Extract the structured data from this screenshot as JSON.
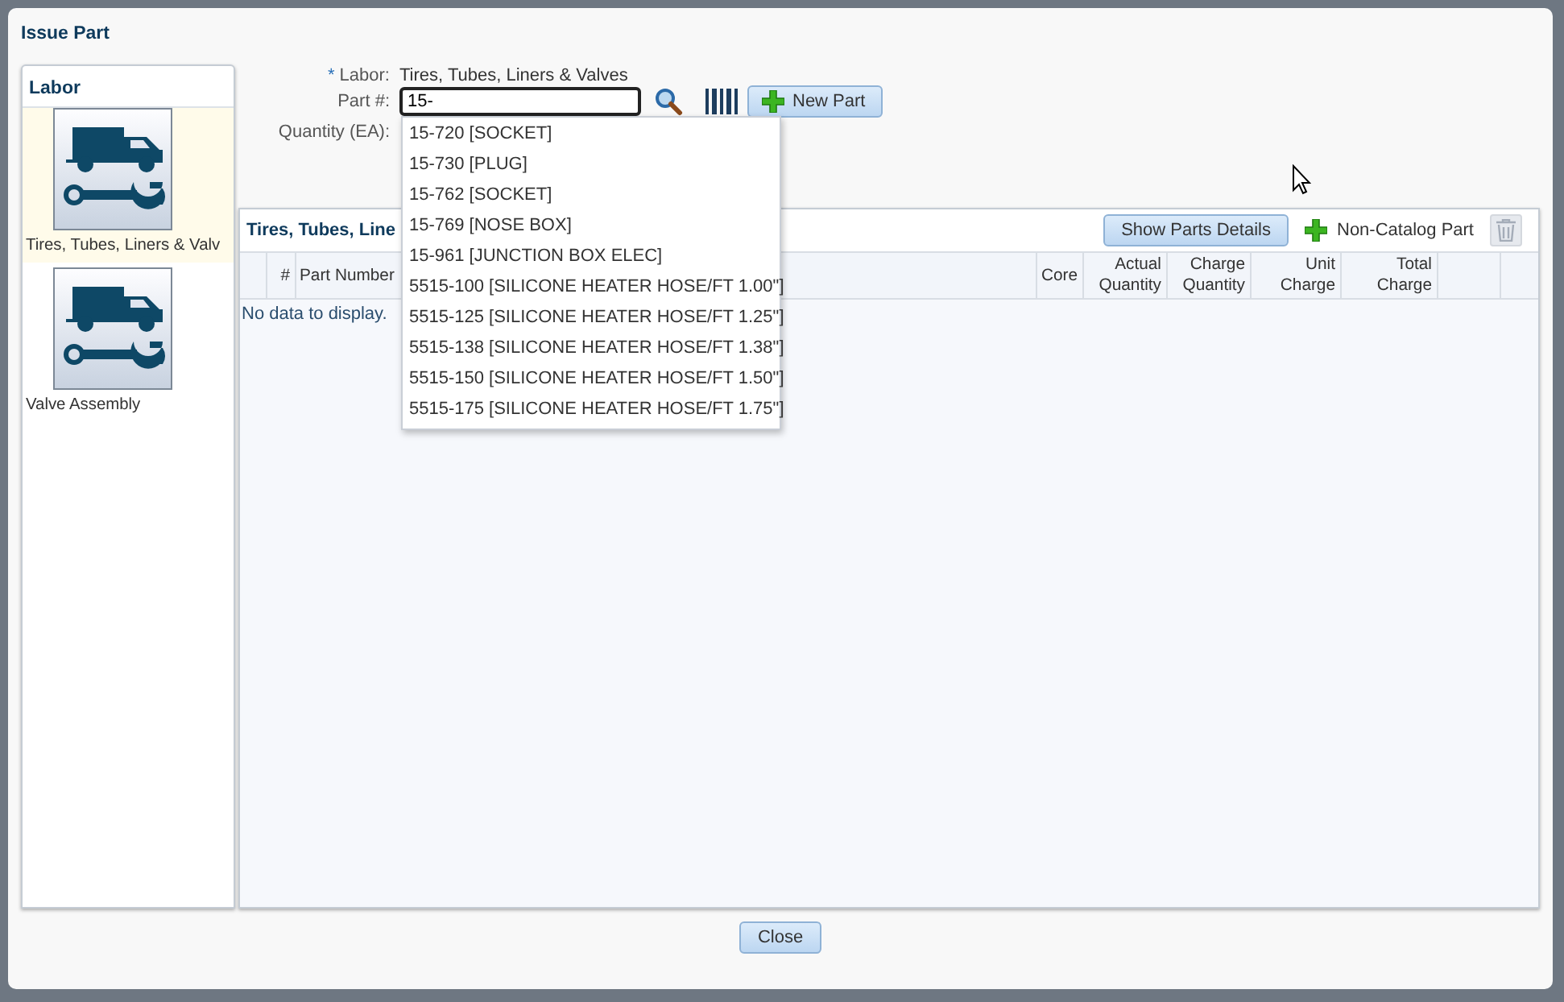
{
  "dialog": {
    "title": "Issue Part"
  },
  "labor_panel": {
    "title": "Labor",
    "items": [
      {
        "label": "Tires, Tubes, Liners & Valv",
        "selected": true
      },
      {
        "label": "Valve Assembly",
        "selected": false
      }
    ]
  },
  "form": {
    "required_mark": "*",
    "labor_label": "Labor:",
    "labor_value": "Tires, Tubes, Liners & Valves",
    "part_label": "Part #:",
    "part_value": "15-",
    "quantity_label": "Quantity (EA):",
    "new_part_button": "New Part"
  },
  "suggestions": [
    "15-720 [SOCKET]",
    "15-730 [PLUG]",
    "15-762 [SOCKET]",
    "15-769 [NOSE BOX]",
    "15-961 [JUNCTION BOX ELEC]",
    "5515-100 [SILICONE HEATER HOSE/FT 1.00\"]",
    "5515-125 [SILICONE HEATER HOSE/FT 1.25\"]",
    "5515-138 [SILICONE HEATER HOSE/FT 1.38\"]",
    "5515-150 [SILICONE HEATER HOSE/FT 1.50\"]",
    "5515-175 [SILICONE HEATER HOSE/FT 1.75\"]"
  ],
  "parts_panel": {
    "title": "Tires, Tubes, Line",
    "show_details_button": "Show Parts Details",
    "non_catalog_button": "Non-Catalog Part",
    "delete_disabled": true,
    "columns": [
      "#",
      "Part Number",
      "Core",
      "Actual Quantity",
      "Charge Quantity",
      "Unit Charge",
      "Total Charge"
    ],
    "empty_text": "No data to display."
  },
  "close_button": "Close"
}
